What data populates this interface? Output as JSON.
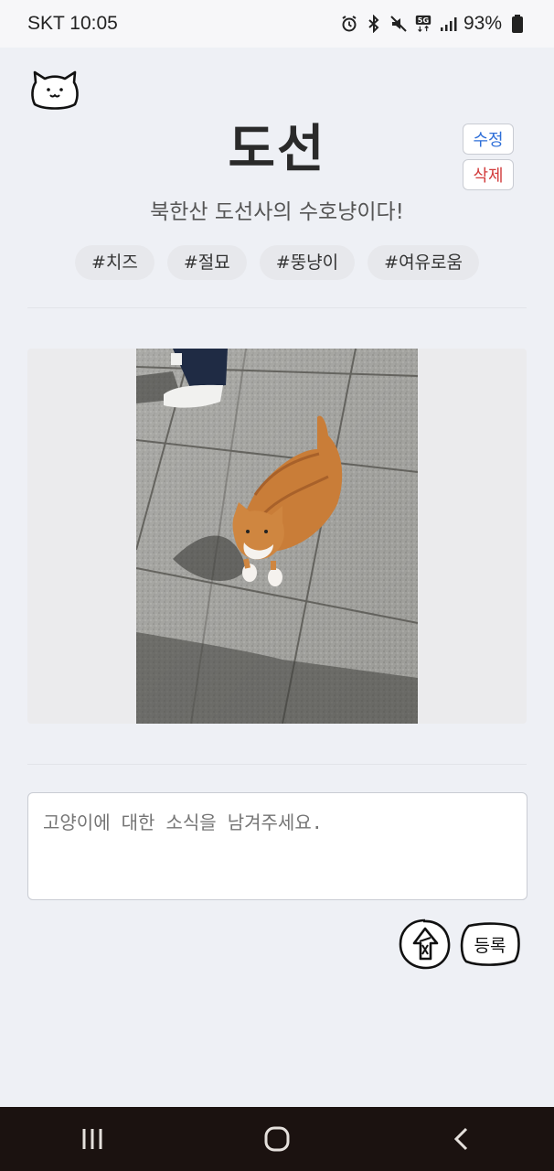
{
  "status_bar": {
    "time": "SKT 10:05",
    "battery": "93%",
    "icons": [
      "alarm-icon",
      "bluetooth-icon",
      "mute-icon",
      "5g-icon",
      "signal-icon",
      "battery-icon"
    ]
  },
  "header": {
    "logo_icon": "cat-face-icon",
    "title": "도선",
    "edit_label": "수정",
    "delete_label": "삭제",
    "subtitle": "북한산 도선사의 수호냥이다!"
  },
  "tags": [
    "#치즈",
    "#절묘",
    "#뚱냥이",
    "#여유로움"
  ],
  "photo": {
    "description_icon": "cat-photo"
  },
  "comment": {
    "placeholder": "고양이에 대한 소식을 남겨주세요."
  },
  "actions": {
    "upload_icon": "hand-drawn-upload-icon",
    "register_label": "등록"
  },
  "nav": {
    "recent_icon": "recent-apps-icon",
    "home_icon": "home-icon",
    "back_icon": "back-icon"
  },
  "colors": {
    "background": "#eef0f5",
    "edit": "#2f6fd8",
    "delete": "#d23c3c",
    "nav_bar": "#1b1210"
  }
}
